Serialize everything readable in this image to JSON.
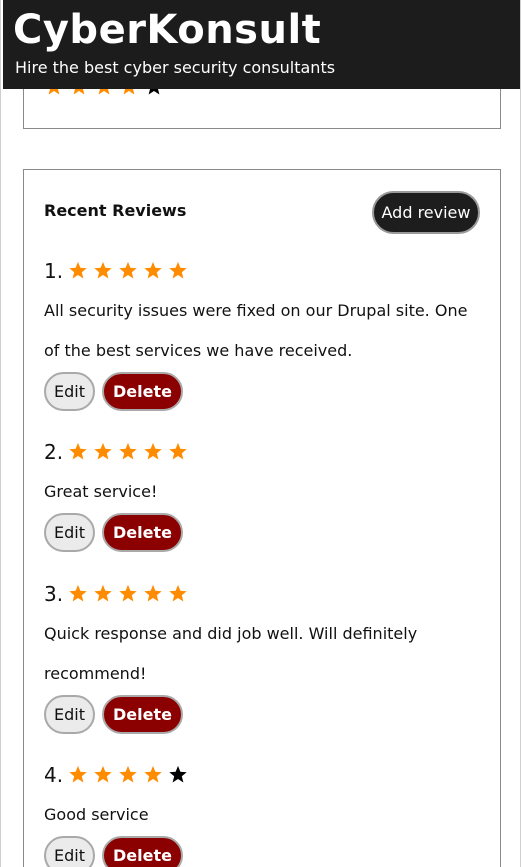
{
  "header": {
    "title": "CyberKonsult",
    "tagline": "Hire the best cyber security consultants"
  },
  "previous_card": {
    "rating": 4,
    "max_rating": 5
  },
  "reviews_section": {
    "heading": "Recent Reviews",
    "add_review_label": "Add review",
    "edit_label": "Edit",
    "delete_label": "Delete",
    "reviews": [
      {
        "number": "1.",
        "rating": 5,
        "text": "All security issues were fixed on our Drupal site. One of the best services we have received."
      },
      {
        "number": "2.",
        "rating": 5,
        "text": "Great service!"
      },
      {
        "number": "3.",
        "rating": 5,
        "text": "Quick response and did job well. Will definitely recommend!"
      },
      {
        "number": "4.",
        "rating": 4,
        "text": "Good service"
      }
    ]
  },
  "colors": {
    "header_bg": "#1c1c1c",
    "star_filled": "#ff8c00",
    "star_empty": "#000000",
    "delete_bg": "#8b0000",
    "add_review_bg": "#1d1d1d"
  }
}
